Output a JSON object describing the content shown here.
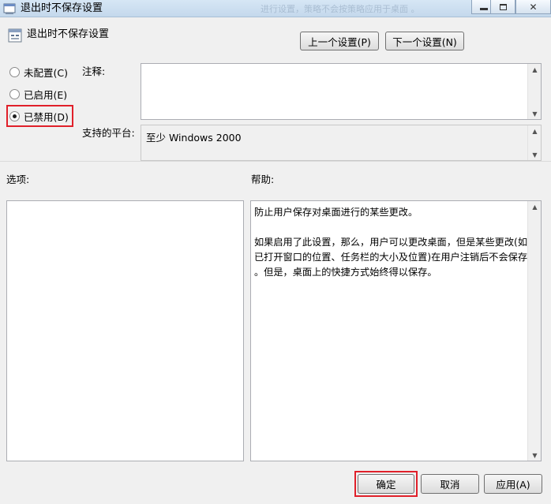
{
  "window": {
    "title": "退出时不保存设置",
    "bg_hint": "进行设置，策略不会按策略应用于桌面 。"
  },
  "policy": {
    "name": "退出时不保存设置"
  },
  "nav": {
    "prev": "上一个设置(P)",
    "next": "下一个设置(N)"
  },
  "state": {
    "options": [
      {
        "label": "未配置(C)",
        "checked": false
      },
      {
        "label": "已启用(E)",
        "checked": false
      },
      {
        "label": "已禁用(D)",
        "checked": true
      }
    ]
  },
  "comment": {
    "label": "注释:",
    "value": ""
  },
  "platform": {
    "label": "支持的平台:",
    "value": "至少 Windows 2000"
  },
  "options_pane": {
    "label": "选项:"
  },
  "help": {
    "label": "帮助:",
    "text": "防止用户保存对桌面进行的某些更改。\n\n如果启用了此设置，那么，用户可以更改桌面，但是某些更改(如\n已打开窗口的位置、任务栏的大小及位置)在用户注销后不会保存\n。但是，桌面上的快捷方式始终得以保存。"
  },
  "buttons": {
    "ok": "确定",
    "cancel": "取消",
    "apply": "应用(A)"
  }
}
